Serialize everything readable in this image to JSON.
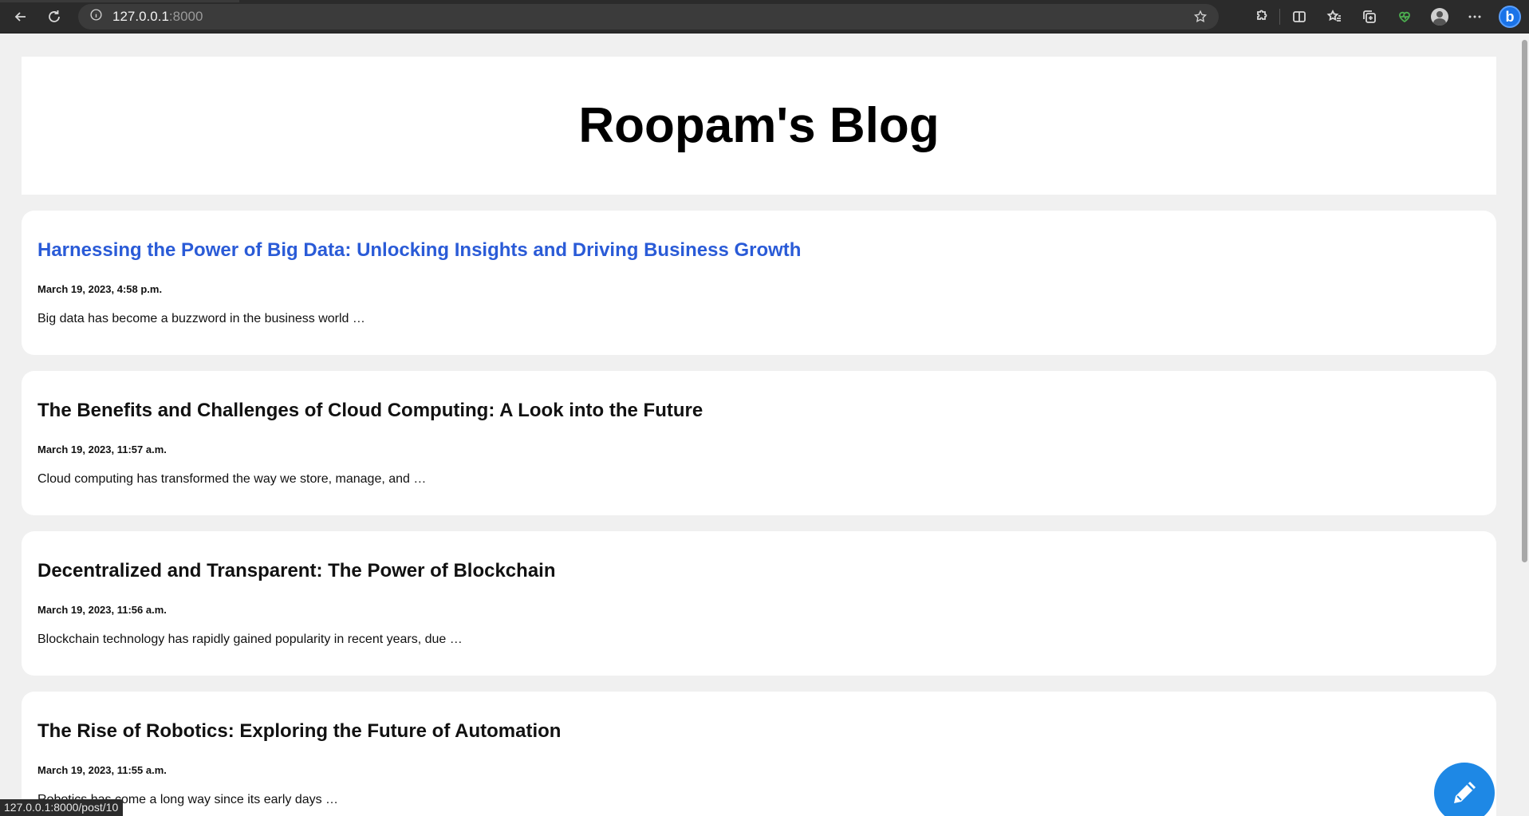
{
  "browser": {
    "url_host": "127.0.0.1",
    "url_port": ":8000",
    "status_url": "127.0.0.1:8000/post/10"
  },
  "page": {
    "blog_title": "Roopam's Blog"
  },
  "posts": [
    {
      "title": "Harnessing the Power of Big Data: Unlocking Insights and Driving Business Growth",
      "date": "March 19, 2023, 4:58 p.m.",
      "excerpt": "Big data has become a buzzword in the business world …",
      "hovered": true
    },
    {
      "title": "The Benefits and Challenges of Cloud Computing: A Look into the Future",
      "date": "March 19, 2023, 11:57 a.m.",
      "excerpt": "Cloud computing has transformed the way we store, manage, and …",
      "hovered": false
    },
    {
      "title": "Decentralized and Transparent: The Power of Blockchain",
      "date": "March 19, 2023, 11:56 a.m.",
      "excerpt": "Blockchain technology has rapidly gained popularity in recent years, due …",
      "hovered": false
    },
    {
      "title": "The Rise of Robotics: Exploring the Future of Automation",
      "date": "March 19, 2023, 11:55 a.m.",
      "excerpt": "Robotics has come a long way since its early days …",
      "hovered": false
    }
  ],
  "colors": {
    "link_hover": "#2a5bd7",
    "fab": "#1e88e5",
    "page_bg": "#f0f0f0"
  },
  "icons": {
    "back": "back-arrow-icon",
    "reload": "reload-icon",
    "info": "site-info-icon",
    "favorite": "star-icon",
    "extensions": "puzzle-icon",
    "split": "split-screen-icon",
    "favorites": "favorites-icon",
    "collections": "collections-icon",
    "health": "heart-pulse-icon",
    "profile": "profile-icon",
    "more": "more-icon",
    "copilot": "bing-icon",
    "new_post": "pencil-icon"
  }
}
